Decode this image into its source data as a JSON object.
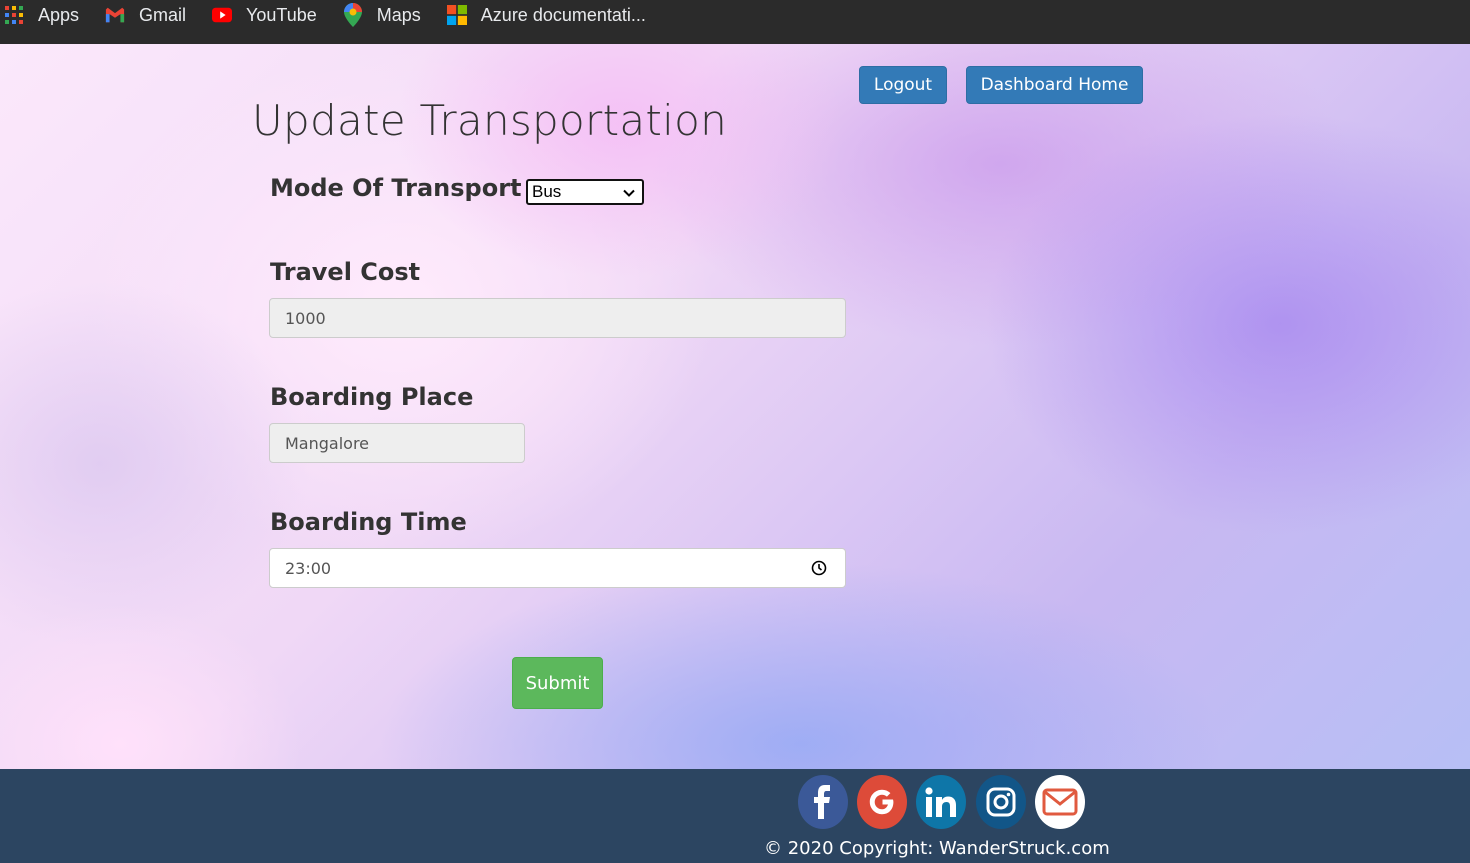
{
  "bookmarks": [
    {
      "label": "Apps",
      "icon": "apps-grid-icon"
    },
    {
      "label": "Gmail",
      "icon": "gmail-icon"
    },
    {
      "label": "YouTube",
      "icon": "youtube-icon"
    },
    {
      "label": "Maps",
      "icon": "maps-pin-icon"
    },
    {
      "label": "Azure documentati...",
      "icon": "microsoft-logo-icon"
    }
  ],
  "page": {
    "title": "Update Transportation",
    "logout_label": "Logout",
    "dashboard_label": "Dashboard Home"
  },
  "form": {
    "mode_label": "Mode Of Transport",
    "mode_value": "Bus",
    "cost_label": "Travel Cost",
    "cost_value": "1000",
    "boarding_place_label": "Boarding Place",
    "boarding_place_value": "Mangalore",
    "boarding_time_label": "Boarding Time",
    "boarding_time_value": "23:00",
    "submit_label": "Submit"
  },
  "footer": {
    "social": [
      "facebook-icon",
      "google-icon",
      "linkedin-icon",
      "instagram-icon",
      "mail-icon"
    ],
    "copyright": "© 2020 Copyright: WanderStruck.com"
  },
  "colors": {
    "primary_button": "#337ab7",
    "submit_button": "#5cb85c",
    "footer_bg": "#2c4561"
  }
}
